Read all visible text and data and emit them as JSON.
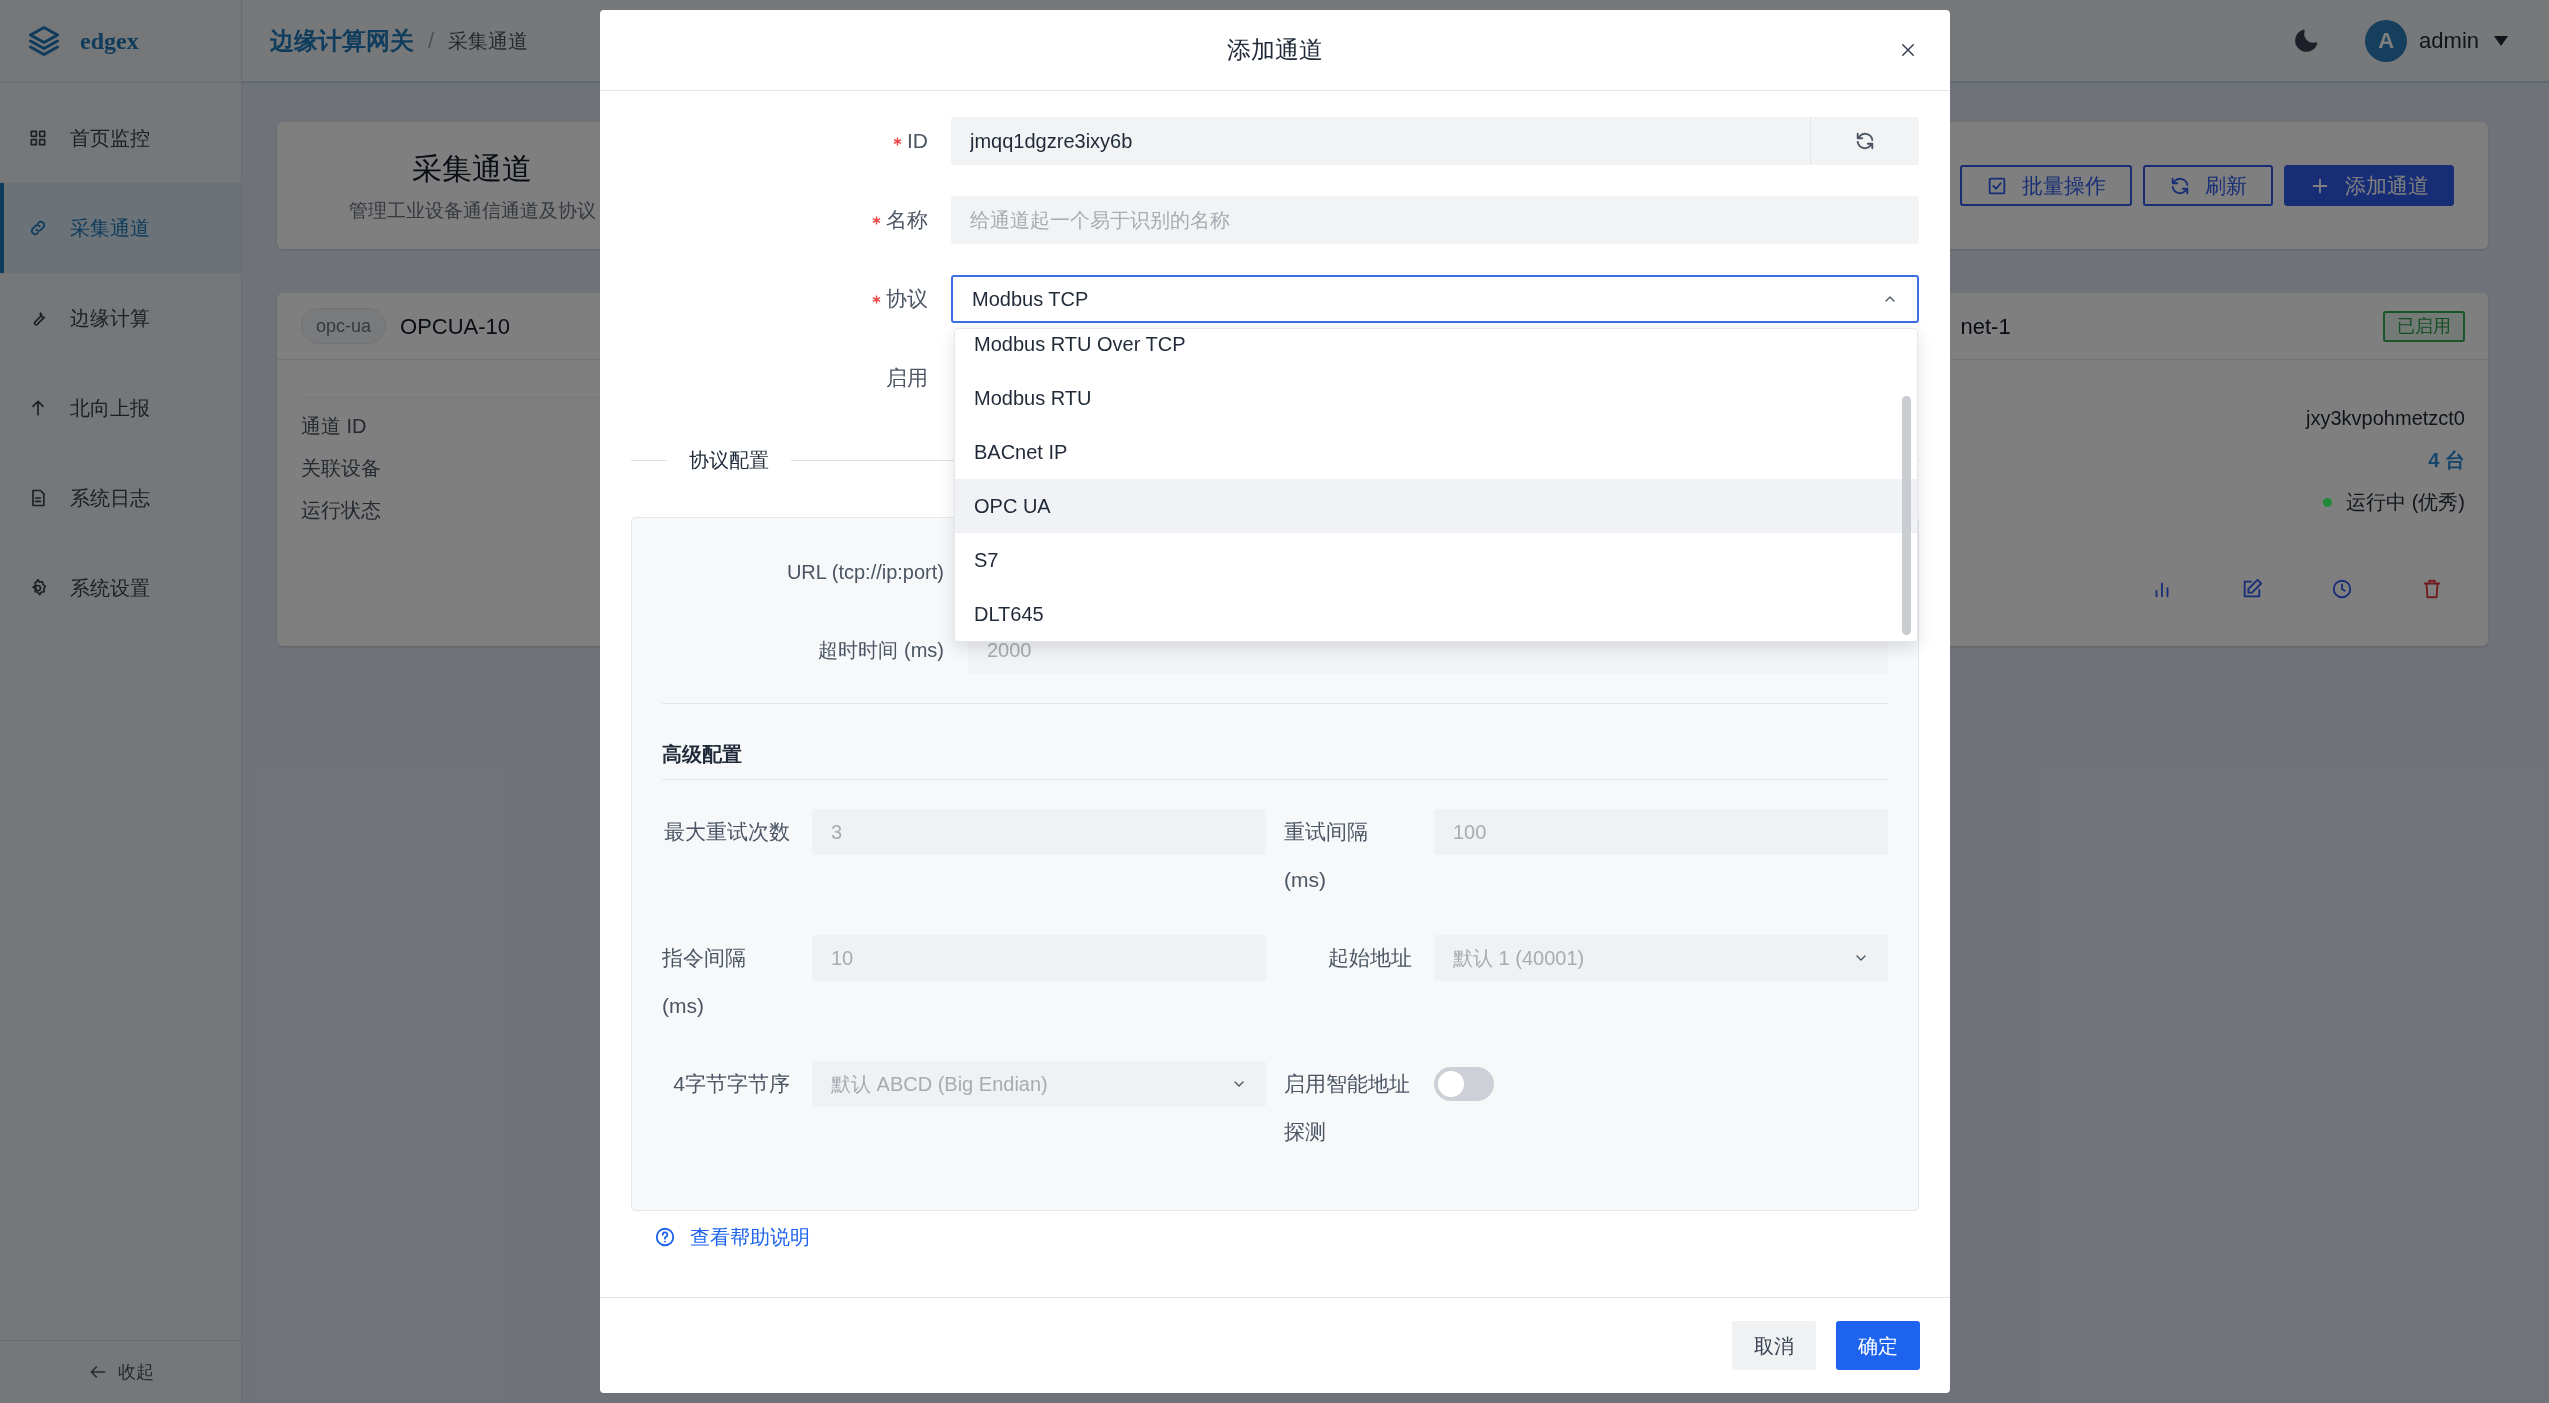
{
  "app": {
    "logo": "edgex",
    "breadcrumb": [
      "边缘计算网关",
      "/",
      "采集通道"
    ],
    "user": {
      "avatar": "A",
      "name": "admin"
    }
  },
  "sidebar": {
    "items": [
      {
        "label": "首页监控",
        "selected": false
      },
      {
        "label": "采集通道",
        "selected": true
      },
      {
        "label": "边缘计算",
        "selected": false
      },
      {
        "label": "北向上报",
        "selected": false
      },
      {
        "label": "系统日志",
        "selected": false
      },
      {
        "label": "系统设置",
        "selected": false
      }
    ],
    "collapse": "收起"
  },
  "page_header": {
    "title": "采集通道",
    "subtitle": "管理工业设备通信通道及协议",
    "buttons": [
      {
        "label": "批量操作",
        "kind": "outline"
      },
      {
        "label": "刷新",
        "kind": "outline"
      },
      {
        "label": "添加通道",
        "kind": "primary"
      }
    ]
  },
  "channel_card_left": {
    "tag": "opc-ua",
    "name": "OPCUA-10",
    "fields": [
      "通道 ID",
      "关联设备",
      "运行状态"
    ]
  },
  "channel_card_right": {
    "name": "net-1",
    "badge": "已启用",
    "channel_id": "jxy3kvpohmetzct0",
    "devices": "4 台",
    "status": {
      "text": "运行中 (优秀)",
      "color": "#1f8a3a"
    }
  },
  "dialog": {
    "title": "添加通道",
    "fields": [
      {
        "kind": "id",
        "label": "ID",
        "required": true,
        "value": "jmqq1dgzre3ixy6b"
      },
      {
        "kind": "text",
        "label": "名称",
        "required": true,
        "placeholder": "给通道起一个易于识别的名称"
      },
      {
        "kind": "select",
        "label": "协议",
        "required": true,
        "value": "Modbus TCP",
        "expanded": true
      },
      {
        "kind": "label_only",
        "label": "启用",
        "required": false
      }
    ],
    "dropdown": [
      {
        "label": "Modbus RTU Over TCP",
        "selected": false
      },
      {
        "label": "Modbus RTU",
        "selected": false
      },
      {
        "label": "BACnet IP",
        "selected": false
      },
      {
        "label": "OPC UA",
        "selected": true
      },
      {
        "label": "S7",
        "selected": false
      },
      {
        "label": "DLT645",
        "selected": false
      }
    ],
    "section": "协议配置",
    "protocol_fields": [
      {
        "label": "URL (tcp://ip:port)"
      },
      {
        "label": "超时时间 (ms)",
        "placeholder": "2000"
      }
    ],
    "advanced": {
      "title": "高级配置",
      "fields": [
        {
          "kind": "input",
          "label": "最大重试次数",
          "placeholder": "3"
        },
        {
          "kind": "input",
          "label": "重试间隔 (ms)",
          "placeholder": "100"
        },
        {
          "kind": "input",
          "label": "指令间隔 (ms)",
          "placeholder": "10"
        },
        {
          "kind": "select",
          "label": "起始地址",
          "placeholder": "默认 1 (40001)"
        },
        {
          "kind": "select",
          "label": "4字节字节序",
          "placeholder": "默认 ABCD (Big Endian)"
        },
        {
          "kind": "switch",
          "label": "启用智能地址探测",
          "on": false
        }
      ]
    },
    "help_link": "查看帮助说明",
    "buttons": [
      {
        "label": "取消",
        "kind": "secondary"
      },
      {
        "label": "确定",
        "kind": "primary"
      }
    ]
  }
}
